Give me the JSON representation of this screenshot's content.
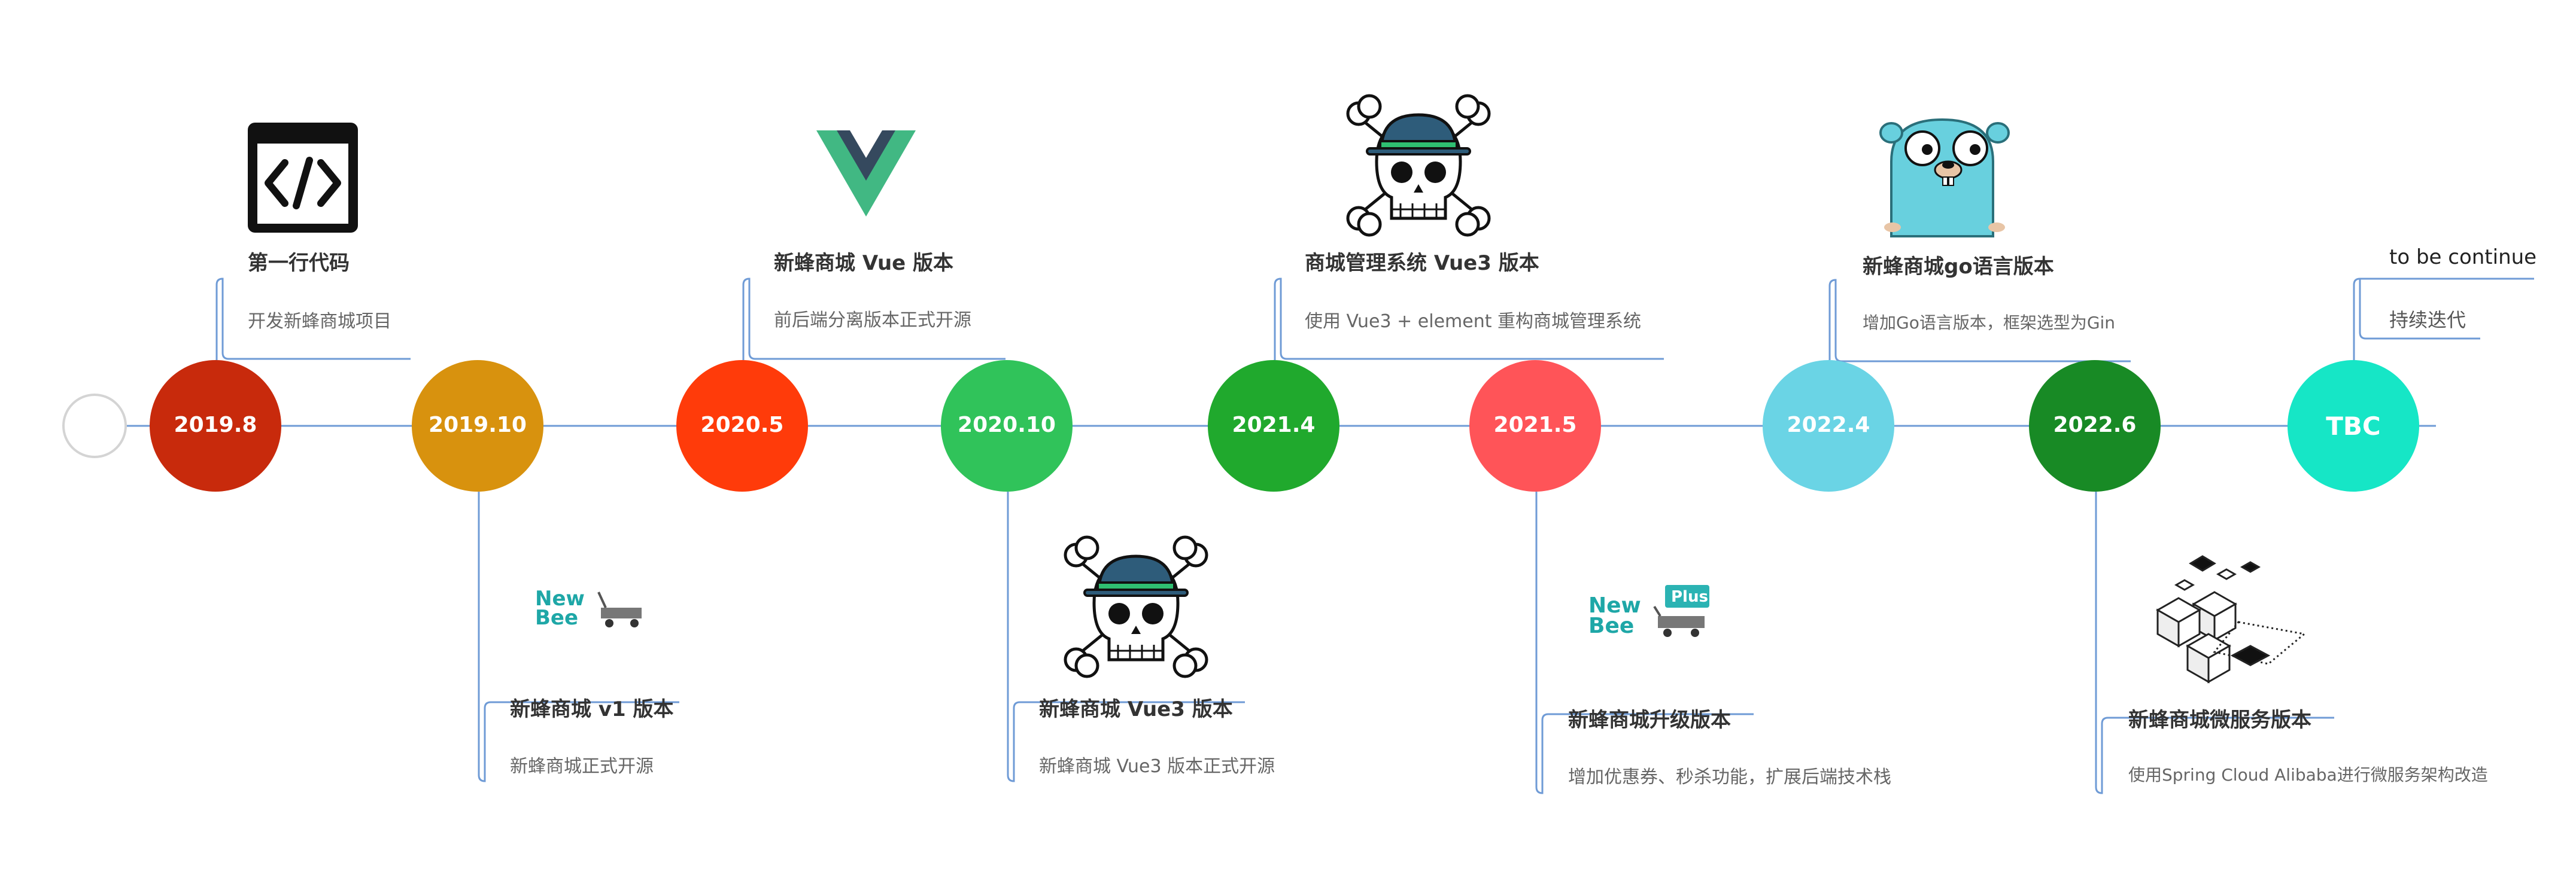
{
  "colors": {
    "line": "#6f9bd6",
    "n1": "#c82a0c",
    "n2": "#d8920e",
    "n3": "#ff3b0a",
    "n4": "#30c35a",
    "n5": "#20a92d",
    "n6": "#ff5458",
    "n7": "#6ad4e5",
    "n8": "#188a25",
    "n9": "#16e6c6"
  },
  "nodes": [
    {
      "label": "2019.8"
    },
    {
      "label": "2019.10"
    },
    {
      "label": "2020.5"
    },
    {
      "label": "2020.10"
    },
    {
      "label": "2021.4"
    },
    {
      "label": "2021.5"
    },
    {
      "label": "2022.4"
    },
    {
      "label": "2022.6"
    },
    {
      "label": "TBC"
    }
  ],
  "events": {
    "e1": {
      "title": "第一行代码",
      "desc": "开发新蜂商城项目",
      "icon": "code-icon"
    },
    "e2": {
      "title": "新蜂商城 v1 版本",
      "desc": "新蜂商城正式开源",
      "icon": "newbee-logo"
    },
    "e3": {
      "title": "新蜂商城 Vue 版本",
      "desc": "前后端分离版本正式开源",
      "icon": "vue-logo"
    },
    "e4": {
      "title": "新蜂商城 Vue3 版本",
      "desc": "新蜂商城 Vue3 版本正式开源",
      "icon": "skull-icon"
    },
    "e5": {
      "title": "商城管理系统 Vue3 版本",
      "desc": "使用 Vue3 + element 重构商城管理系统",
      "icon": "skull-icon"
    },
    "e6": {
      "title": "新蜂商城升级版本",
      "desc": "增加优惠券、秒杀功能，扩展后端技术栈",
      "icon": "newbee-plus-logo"
    },
    "e7": {
      "title": "新蜂商城go语言版本",
      "desc": "增加Go语言版本，框架选型为Gin",
      "icon": "gopher-icon"
    },
    "e8": {
      "title": "新蜂商城微服务版本",
      "desc": "使用Spring Cloud Alibaba进行微服务架构改造",
      "icon": "cubes-icon"
    },
    "e9": {
      "title": "to be continue",
      "desc": "持续迭代"
    }
  },
  "logos": {
    "newbee_line1": "New",
    "newbee_line2": "Bee",
    "plus": "Plus"
  }
}
